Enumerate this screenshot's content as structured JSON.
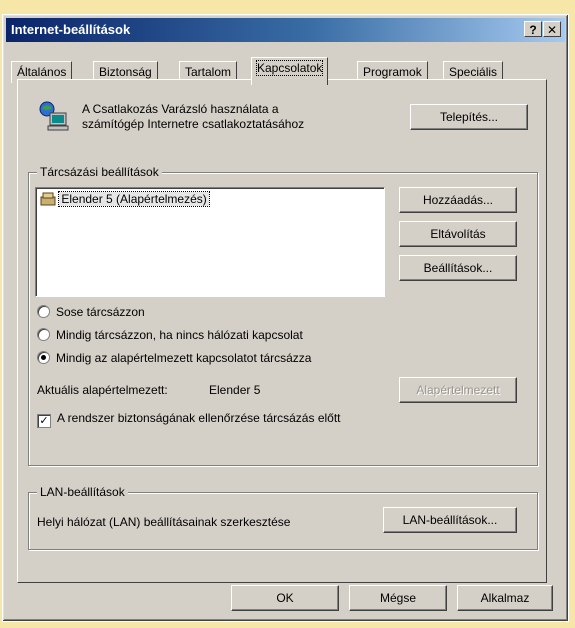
{
  "window": {
    "title": "Internet-beállítások",
    "help_label": "?",
    "close_label": "✕"
  },
  "tabs": [
    "Általános",
    "Biztonság",
    "Tartalom",
    "Kapcsolatok",
    "Programok",
    "Speciális"
  ],
  "active_tab": "Kapcsolatok",
  "wizard": {
    "icon": "network-computer-icon",
    "text_line1": "A Csatlakozás Varázsló használata a",
    "text_line2": "számítógép Internetre csatlakoztatásához",
    "setup_button": "Telepítés..."
  },
  "dialup": {
    "group_label": "Tárcsázási beállítások",
    "connections": [
      {
        "icon": "dialup-connection-icon",
        "label": "Elender 5 (Alapértelmezés)"
      }
    ],
    "add_button": "Hozzáadás...",
    "remove_button": "Eltávolítás",
    "settings_button": "Beállítások...",
    "radio_options": [
      {
        "label": "Sose tárcsázzon",
        "selected": false
      },
      {
        "label": "Mindig tárcsázzon, ha nincs hálózati kapcsolat",
        "selected": false
      },
      {
        "label": "Mindig az alapértelmezett kapcsolatot tárcsázza",
        "selected": true
      }
    ],
    "current_default_label": "Aktuális alapértelmezett:",
    "current_default_value": "Elender 5",
    "set_default_button": "Alapértelmezett",
    "security_check_label": "A rendszer biztonságának ellenőrzése tárcsázás előtt",
    "security_check_checked": true
  },
  "lan": {
    "group_label": "LAN-beállítások",
    "description": "Helyi hálózat (LAN) beállításainak szerkesztése",
    "lan_settings_button": "LAN-beállítások..."
  },
  "footer": {
    "ok_button": "OK",
    "cancel_button": "Mégse",
    "apply_button": "Alkalmaz"
  }
}
